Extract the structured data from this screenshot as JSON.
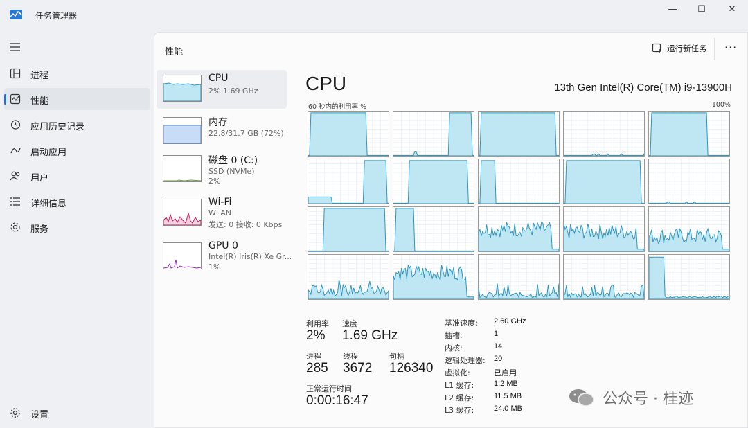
{
  "window": {
    "title": "任务管理器",
    "minimize": "—",
    "maximize": "☐",
    "close": "✕"
  },
  "nav": [
    {
      "label": "进程",
      "icon": "processes-icon"
    },
    {
      "label": "性能",
      "icon": "performance-icon"
    },
    {
      "label": "应用历史记录",
      "icon": "app-history-icon"
    },
    {
      "label": "启动应用",
      "icon": "startup-icon"
    },
    {
      "label": "用户",
      "icon": "users-icon"
    },
    {
      "label": "详细信息",
      "icon": "details-icon"
    },
    {
      "label": "服务",
      "icon": "services-icon"
    }
  ],
  "settings_label": "设置",
  "header": {
    "title": "性能",
    "run_task": "运行新任务",
    "more": "···"
  },
  "devices": [
    {
      "name": "CPU",
      "sub1": "2%  1.69 GHz",
      "sub2": ""
    },
    {
      "name": "内存",
      "sub1": "22.8/31.7 GB (72%)",
      "sub2": ""
    },
    {
      "name": "磁盘 0 (C:)",
      "sub1": "SSD (NVMe)",
      "sub2": "2%"
    },
    {
      "name": "Wi-Fi",
      "sub1": "WLAN",
      "sub2": "发送: 0 接收: 0 Kbps"
    },
    {
      "name": "GPU 0",
      "sub1": "Intel(R) Iris(R) Xe Gr...",
      "sub2": "1%"
    }
  ],
  "cpu": {
    "title": "CPU",
    "model": "13th Gen Intel(R) Core(TM) i9-13900H",
    "axis_left": "60 秒内的利用率 %",
    "axis_right": "100%"
  },
  "stats": {
    "util_label": "利用率",
    "util": "2%",
    "speed_label": "速度",
    "speed": "1.69 GHz",
    "proc_label": "进程",
    "proc": "285",
    "thread_label": "线程",
    "threads": "3672",
    "handle_label": "句柄",
    "handles": "126340",
    "uptime_label": "正常运行时间",
    "uptime": "0:00:16:47"
  },
  "specs": [
    {
      "k": "基准速度:",
      "v": "2.60 GHz"
    },
    {
      "k": "插槽:",
      "v": "1"
    },
    {
      "k": "内核:",
      "v": "14"
    },
    {
      "k": "逻辑处理器:",
      "v": "20"
    },
    {
      "k": "虚拟化:",
      "v": "已启用"
    },
    {
      "k": "L1 缓存:",
      "v": "1.2 MB"
    },
    {
      "k": "L2 缓存:",
      "v": "11.5 MB"
    },
    {
      "k": "L3 缓存:",
      "v": "24.0 MB"
    }
  ],
  "watermark": "公众号 · 桂迹",
  "colors": {
    "accent": "#1f6fc6",
    "cpu_fill": "#bfe6f3",
    "cpu_line": "#2b95bd",
    "mem_fill": "#c9dcf7",
    "mem_line": "#5a8fd6",
    "wifi_line": "#c2185b",
    "gpu_line": "#8e24aa"
  }
}
